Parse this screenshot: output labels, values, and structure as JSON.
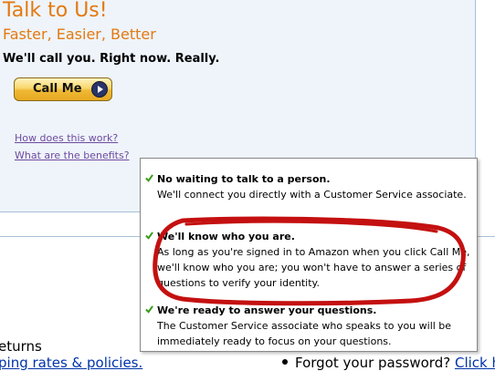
{
  "panel": {
    "title": "Talk to Us!",
    "subtitle": "Faster, Easier, Better",
    "tagline": "We'll call you. Right now. Really.",
    "call_button_label": "Call Me",
    "link_how": "How does this work?",
    "link_benefits": "What are the benefits?"
  },
  "tooltip": {
    "benefits": [
      {
        "heading": "No waiting to talk to a person.",
        "text": "We'll connect you directly with a Customer Service associate."
      },
      {
        "heading": "We'll know who you are.",
        "text": "As long as you're signed in to Amazon when you click Call Me, we'll know who you are; you won't have to answer a series of questions to verify your identity."
      },
      {
        "heading": "We're ready to answer your questions.",
        "text": "The Customer Service associate who speaks to you will be immediately ready to focus on your questions."
      }
    ]
  },
  "bottom": {
    "heading_fragment": "eturns",
    "link_fragment": "ping rates & policies.",
    "bullet_text": "Forgot your password? ",
    "bullet_link": "Click he"
  },
  "colors": {
    "title_orange": "#e47911",
    "link_purple": "#6e4aa0",
    "link_blue": "#0033aa",
    "check_green": "#3a9a1a",
    "annotation_red": "#c41010",
    "panel_bg": "#eef4fa"
  },
  "icons": {
    "check": "check-icon",
    "arrow": "play-arrow-icon",
    "bullet": "bullet-icon"
  }
}
